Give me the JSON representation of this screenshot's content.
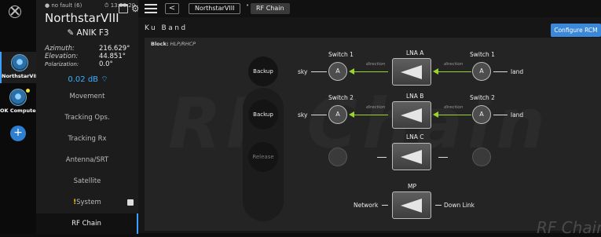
{
  "rail": {
    "terminals": [
      {
        "label": "NorthstarVIII"
      },
      {
        "label": "OK Computer"
      }
    ]
  },
  "status": {
    "fault": "no fault (6)",
    "time": "13:56:20"
  },
  "terminal_name": "NorthstarVIII",
  "satellite": "ANIK F3",
  "position": {
    "azimuth_label": "Azimuth:",
    "azimuth_value": "216.629°",
    "elevation_label": "Elevation:",
    "elevation_value": "44.851°",
    "polarization_label": "Polarization:",
    "polarization_value": "0.0°"
  },
  "signal": "0.02 dB",
  "nav": {
    "items": [
      {
        "label": "Movement"
      },
      {
        "label": "Tracking Ops."
      },
      {
        "label": "Tracking Rx"
      },
      {
        "label": "Antenna/SRT"
      },
      {
        "label": "Satellite"
      },
      {
        "warn": "!",
        "label": "System"
      },
      {
        "label": "RF Chain"
      }
    ]
  },
  "breadcrumb": {
    "back": "<",
    "terminal": "NorthstarVIII",
    "separator": "•",
    "page": "RF Chain"
  },
  "main": {
    "title": "Ku Band",
    "configure_button": "Configure RCM",
    "block_label": "Block:",
    "block_value": "HLP/RHCP",
    "watermark": "RF Chain",
    "watermark_small": "RF Chain"
  },
  "actions": {
    "backup1": "Backup",
    "backup2": "Backup",
    "release": "Release"
  },
  "rf": {
    "rows": [
      {
        "left_label": "sky",
        "left_title": "Switch 1",
        "left_switch": "A",
        "lna": "LNA A",
        "right_title": "Switch 1",
        "right_switch": "A",
        "right_label": "land",
        "dir_left": "direction",
        "dir_right": "direction"
      },
      {
        "left_label": "sky",
        "left_title": "Switch 2",
        "left_switch": "A",
        "lna": "LNA B",
        "right_title": "Switch 2",
        "right_switch": "A",
        "right_label": "land",
        "dir_left": "direction",
        "dir_right": "direction"
      },
      {
        "lna": "LNA C"
      },
      {
        "lna": "MP",
        "left_label": "Network",
        "right_label": "Down Link"
      }
    ]
  },
  "colors": {
    "accent": "#3b87d9",
    "flow": "#9ad62a",
    "warn": "#f0d020"
  }
}
